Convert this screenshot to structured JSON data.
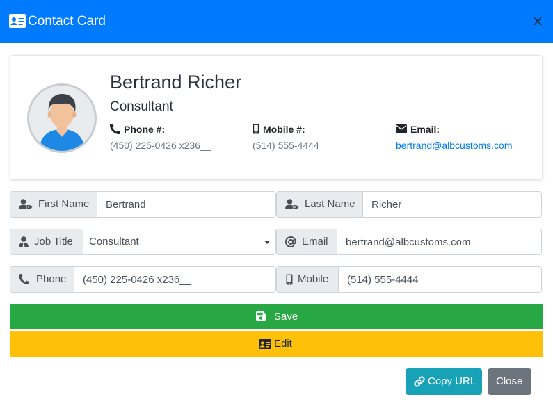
{
  "header": {
    "title": "Contact Card",
    "close_glyph": "×",
    "icon": "id-card-icon"
  },
  "card": {
    "name": "Bertrand Richer",
    "job_title": "Consultant",
    "avatar_icon": "user-avatar",
    "phone": {
      "label": "Phone #:",
      "value": "(450) 225-0426 x236__",
      "icon": "phone-icon"
    },
    "mobile": {
      "label": "Mobile #:",
      "value": "(514) 555-4444",
      "icon": "mobile-icon"
    },
    "email": {
      "label": "Email:",
      "value": "bertrand@albcustoms.com",
      "icon": "envelope-icon"
    }
  },
  "form": {
    "first_name": {
      "label": "First Name",
      "value": "Bertrand",
      "icon": "user-tag-icon"
    },
    "last_name": {
      "label": "Last Name",
      "value": "Richer",
      "icon": "user-tag-icon"
    },
    "job_title": {
      "label": "Job Title",
      "value": "Consultant",
      "icon": "user-tie-icon"
    },
    "email": {
      "label": "Email",
      "value": "bertrand@albcustoms.com",
      "icon": "at-icon"
    },
    "phone": {
      "label": "Phone",
      "value": "(450) 225-0426 x236__",
      "icon": "phone-icon"
    },
    "mobile": {
      "label": "Mobile",
      "value": "(514) 555-4444",
      "icon": "mobile-icon"
    }
  },
  "actions": {
    "save": "Save",
    "edit": "Edit",
    "copy_url": "Copy URL",
    "close": "Close"
  },
  "colors": {
    "primary": "#007bff",
    "success": "#28a745",
    "warning": "#ffc107",
    "info": "#17a2b8",
    "secondary": "#6c757d"
  }
}
